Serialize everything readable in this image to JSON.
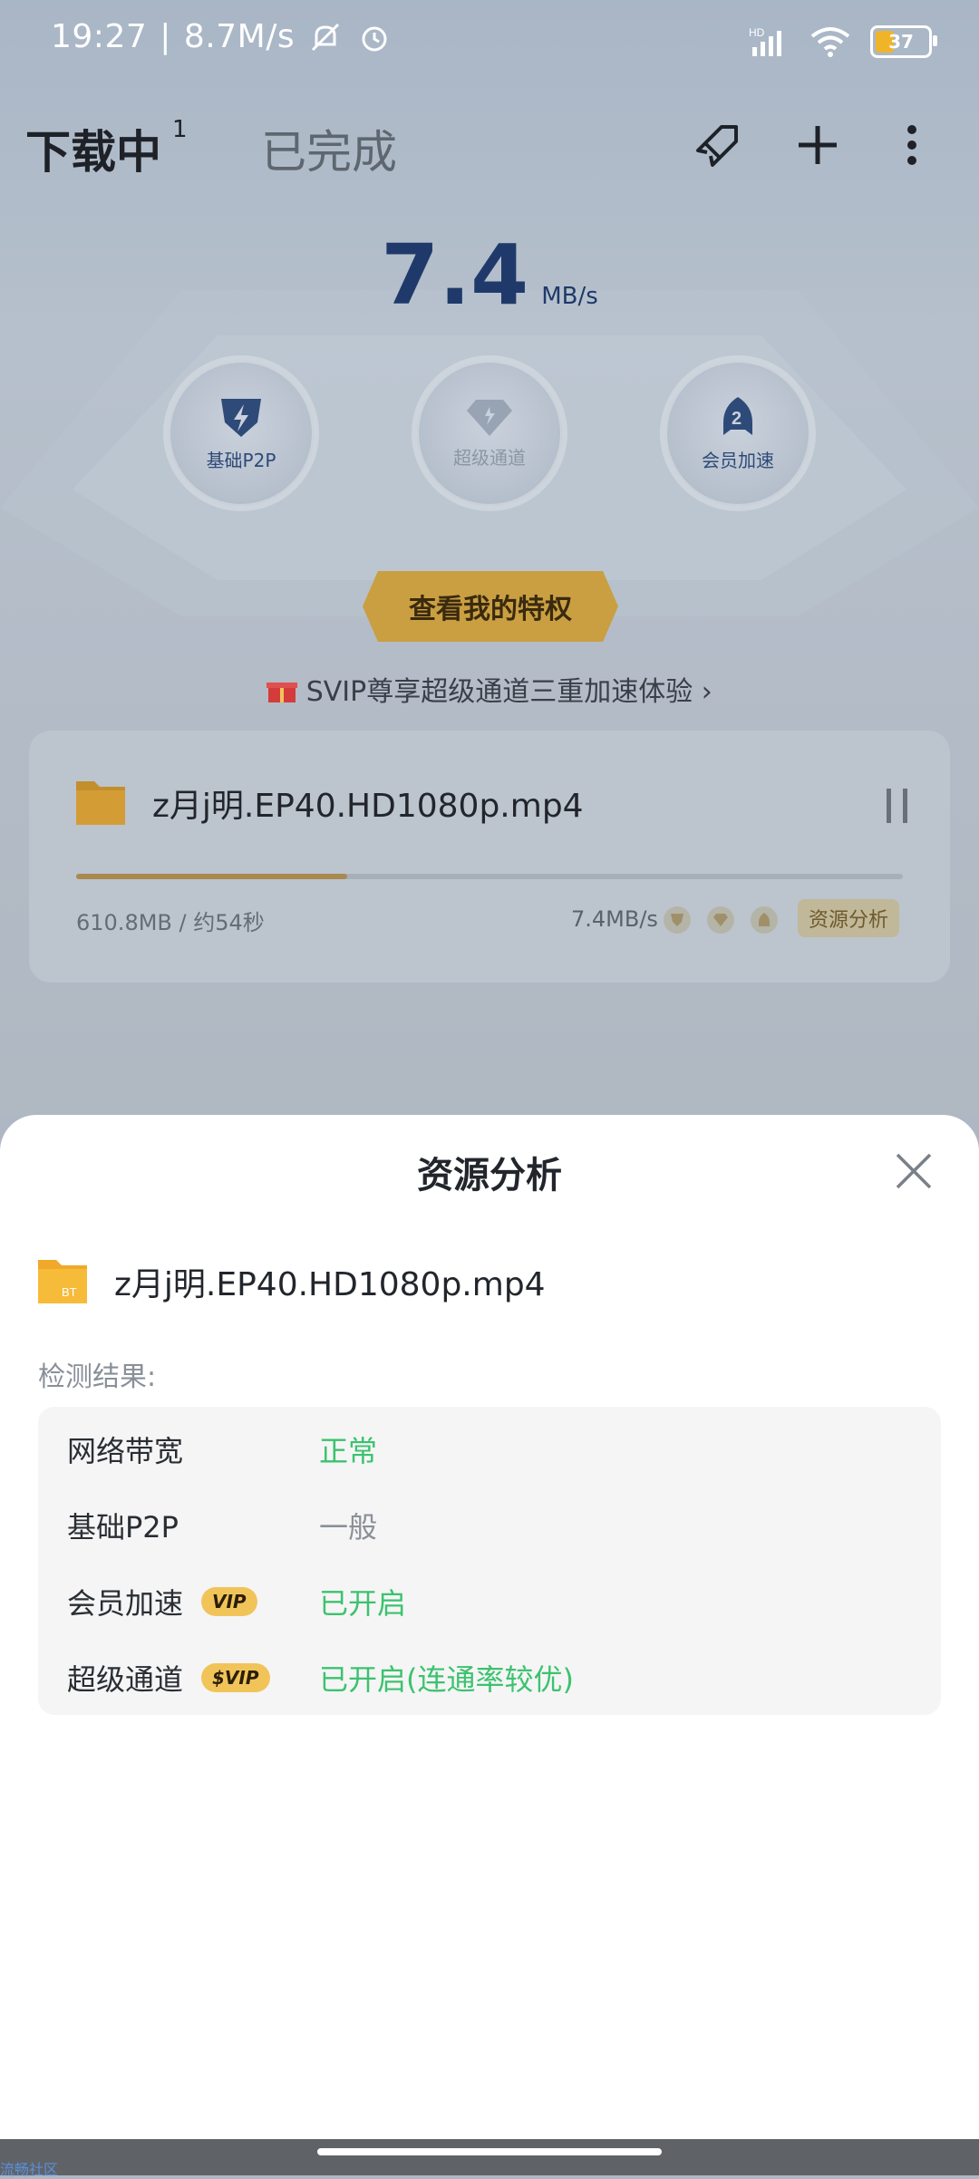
{
  "status_bar": {
    "time": "19:27",
    "net_speed": "8.7M/s",
    "battery": "37",
    "hd_label": "HD"
  },
  "header": {
    "tab_downloading": "下载中",
    "tab_downloading_count": "1",
    "tab_completed": "已完成"
  },
  "speed": {
    "value": "7.4",
    "unit": "MB/s"
  },
  "modes": [
    {
      "label": "基础P2P",
      "icon": "lightning-shield-icon",
      "active": true
    },
    {
      "label": "超级通道",
      "icon": "diamond-icon",
      "active": false
    },
    {
      "label": "会员加速",
      "icon": "rocket-icon",
      "active": true
    }
  ],
  "privilege_button": "查看我的特权",
  "promo": "SVIP尊享超级通道三重加速体验",
  "download": {
    "file_name": "z月j明.EP40.HD1080p.mp4",
    "folder_tag": "BT",
    "size_eta": "610.8MB / 约54秒",
    "rate": "7.4MB/s",
    "progress": 0.328,
    "analysis_label": "资源分析"
  },
  "sheet": {
    "title": "资源分析",
    "file_name": "z月j明.EP40.HD1080p.mp4",
    "detect_label": "检测结果:",
    "rows": [
      {
        "name": "网络带宽",
        "value": "正常",
        "status": "green"
      },
      {
        "name": "基础P2P",
        "value": "一般",
        "status": "grey"
      },
      {
        "name": "会员加速",
        "badge": "VIP",
        "value": "已开启",
        "status": "green"
      },
      {
        "name": "超级通道",
        "badge": "$VIP",
        "value": "已开启(连通率较优)",
        "status": "green"
      }
    ]
  },
  "watermark": "流畅社区",
  "colors": {
    "accent_green": "#3cc26f",
    "gold": "#c99f42",
    "navy": "#1f3a6a"
  }
}
